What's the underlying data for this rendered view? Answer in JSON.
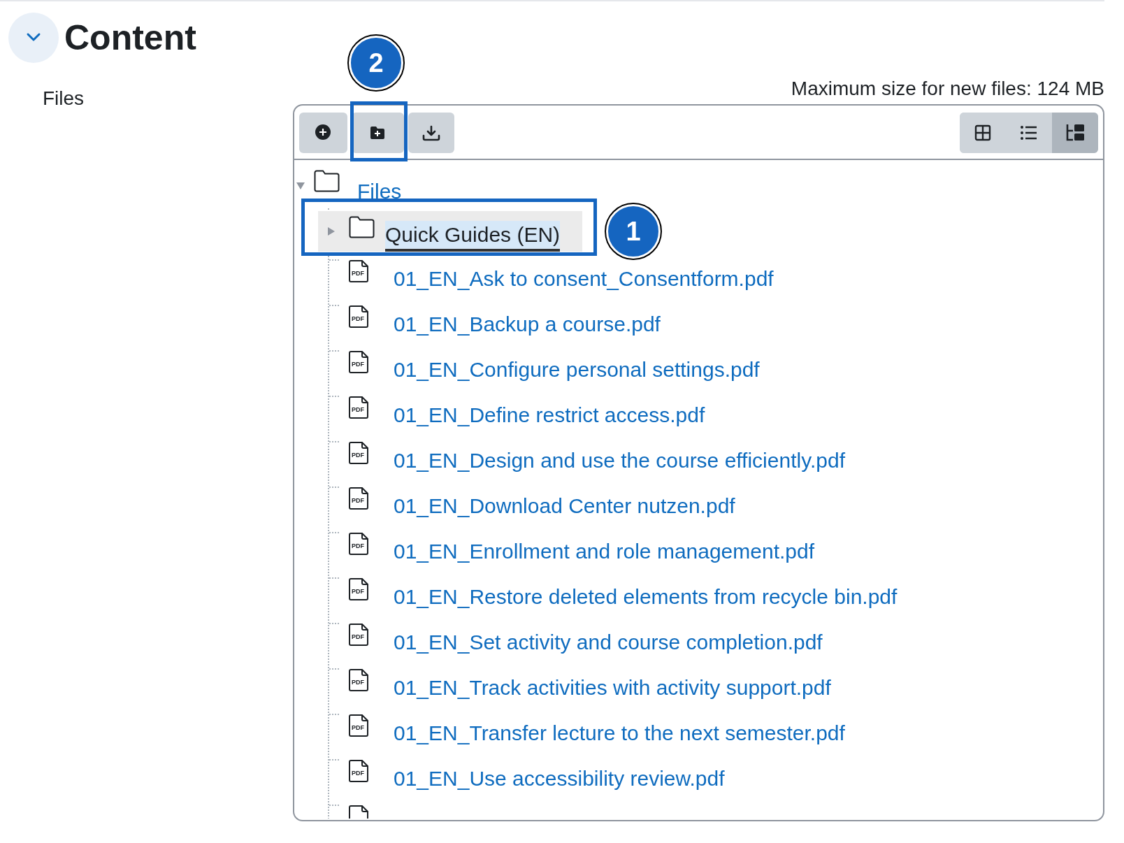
{
  "section": {
    "title": "Content",
    "expanded": true
  },
  "field_label": "Files",
  "max_size": "Maximum size for new files: 124 MB",
  "toolbar": {
    "actions": [
      {
        "kind": "add"
      },
      {
        "kind": "new-folder",
        "callout": "2"
      },
      {
        "kind": "download"
      }
    ],
    "views": [
      {
        "kind": "icons",
        "selected": false
      },
      {
        "kind": "list",
        "selected": false
      },
      {
        "kind": "tree",
        "selected": true
      }
    ]
  },
  "tree": {
    "label": "Files",
    "expanded": true,
    "children": [
      {
        "kind": "folder",
        "label": "Quick Guides (EN)",
        "expanded": false,
        "selected": true,
        "callout": "1"
      },
      {
        "kind": "file",
        "type": "PDF",
        "label": "01_EN_Ask to consent_Consentform.pdf"
      },
      {
        "kind": "file",
        "type": "PDF",
        "label": "01_EN_Backup a course.pdf"
      },
      {
        "kind": "file",
        "type": "PDF",
        "label": "01_EN_Configure personal settings.pdf"
      },
      {
        "kind": "file",
        "type": "PDF",
        "label": "01_EN_Define restrict access.pdf"
      },
      {
        "kind": "file",
        "type": "PDF",
        "label": "01_EN_Design and use the course efficiently.pdf"
      },
      {
        "kind": "file",
        "type": "PDF",
        "label": "01_EN_Download Center nutzen.pdf"
      },
      {
        "kind": "file",
        "type": "PDF",
        "label": "01_EN_Enrollment and role management.pdf"
      },
      {
        "kind": "file",
        "type": "PDF",
        "label": "01_EN_Restore deleted elements from recycle bin.pdf"
      },
      {
        "kind": "file",
        "type": "PDF",
        "label": "01_EN_Set activity and course completion.pdf"
      },
      {
        "kind": "file",
        "type": "PDF",
        "label": "01_EN_Track activities with activity support.pdf"
      },
      {
        "kind": "file",
        "type": "PDF",
        "label": "01_EN_Transfer lecture to the next semester.pdf"
      },
      {
        "kind": "file",
        "type": "PDF",
        "label": "01_EN_Use accessibility review.pdf"
      },
      {
        "kind": "file"
      }
    ]
  }
}
